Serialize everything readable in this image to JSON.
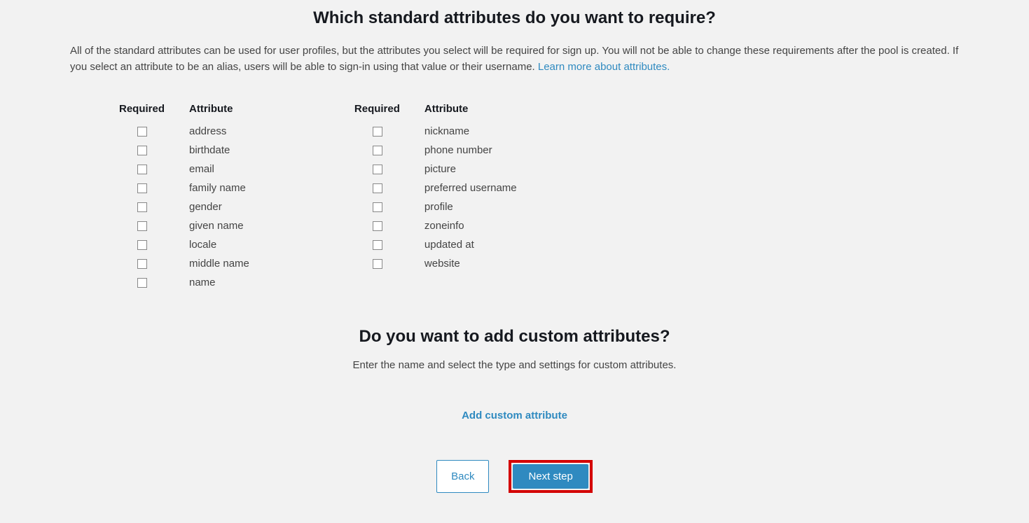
{
  "heading1": "Which standard attributes do you want to require?",
  "desc_text": "All of the standard attributes can be used for user profiles, but the attributes you select will be required for sign up. You will not be able to change these requirements after the pool is created. If you select an attribute to be an alias, users will be able to sign-in using that value or their username. ",
  "desc_link": "Learn more about attributes.",
  "col_required_header": "Required",
  "col_attribute_header": "Attribute",
  "left_attrs": [
    "address",
    "birthdate",
    "email",
    "family name",
    "gender",
    "given name",
    "locale",
    "middle name",
    "name"
  ],
  "right_attrs": [
    "nickname",
    "phone number",
    "picture",
    "preferred username",
    "profile",
    "zoneinfo",
    "updated at",
    "website"
  ],
  "heading2": "Do you want to add custom attributes?",
  "subdesc": "Enter the name and select the type and settings for custom attributes.",
  "add_link": "Add custom attribute",
  "btn_back": "Back",
  "btn_next": "Next step"
}
